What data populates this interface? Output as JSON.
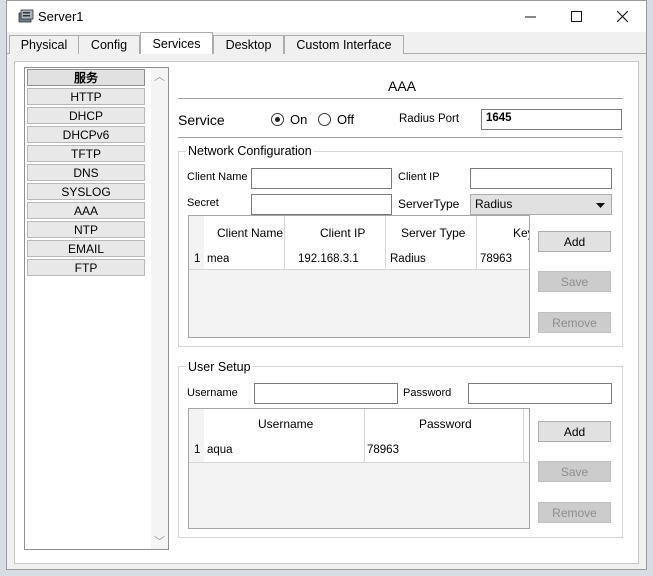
{
  "window": {
    "title": "Server1",
    "minimize": "—",
    "maximize": "☐",
    "close": "✕"
  },
  "tabs": [
    {
      "label": "Physical"
    },
    {
      "label": "Config"
    },
    {
      "label": "Services"
    },
    {
      "label": "Desktop"
    },
    {
      "label": "Custom Interface"
    }
  ],
  "services": {
    "header": "服务",
    "items": [
      "HTTP",
      "DHCP",
      "DHCPv6",
      "TFTP",
      "DNS",
      "SYSLOG",
      "AAA",
      "NTP",
      "EMAIL",
      "FTP"
    ]
  },
  "aaa": {
    "title": "AAA",
    "service_label": "Service",
    "on_label": "On",
    "off_label": "Off",
    "service_on": true,
    "radius_port_label": "Radius Port",
    "radius_port_value": "1645",
    "network": {
      "title": "Network Configuration",
      "client_name_label": "Client Name",
      "client_name_value": "",
      "client_ip_label": "Client IP",
      "client_ip_value": "",
      "secret_label": "Secret",
      "secret_value": "",
      "server_type_label": "ServerType",
      "server_type_value": "Radius",
      "columns": [
        "Client Name",
        "Client IP",
        "Server Type",
        "Key"
      ],
      "rows": [
        {
          "index": "1",
          "client_name": "mea",
          "client_ip": "192.168.3.1",
          "server_type": "Radius",
          "key": "78963"
        }
      ],
      "add_label": "Add",
      "save_label": "Save",
      "remove_label": "Remove"
    },
    "users": {
      "title": "User Setup",
      "username_label": "Username",
      "username_value": "",
      "password_label": "Password",
      "password_value": "",
      "columns": [
        "Username",
        "Password"
      ],
      "rows": [
        {
          "index": "1",
          "username": "aqua",
          "password": "78963"
        }
      ],
      "add_label": "Add",
      "save_label": "Save",
      "remove_label": "Remove"
    }
  }
}
